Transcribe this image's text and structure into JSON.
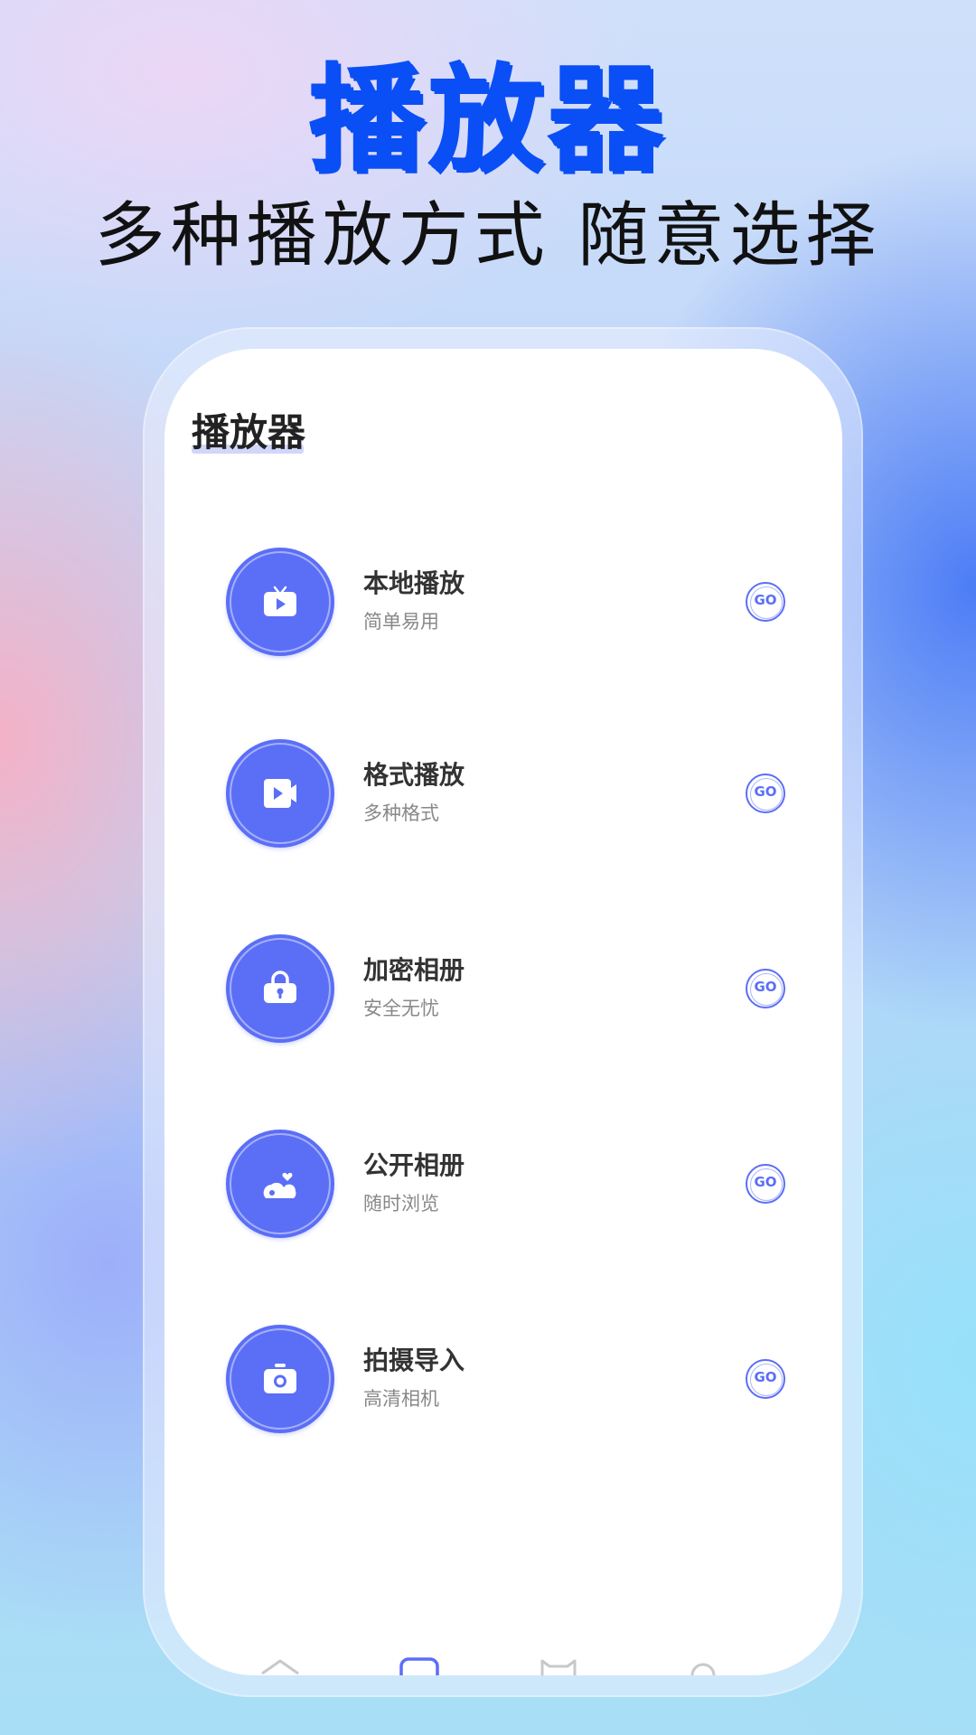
{
  "hero": {
    "title": "播放器",
    "subtitle": "多种播放方式 随意选择"
  },
  "screen": {
    "title": "播放器"
  },
  "colors": {
    "accent": "#5b6ef6",
    "hero_title": "#0a4ef5"
  },
  "menu": [
    {
      "title": "本地播放",
      "subtitle": "简单易用",
      "icon": "tv-play-icon",
      "go": "GO"
    },
    {
      "title": "格式播放",
      "subtitle": "多种格式",
      "icon": "video-camera-icon",
      "go": "GO"
    },
    {
      "title": "加密相册",
      "subtitle": "安全无忧",
      "icon": "lock-bag-icon",
      "go": "GO"
    },
    {
      "title": "公开相册",
      "subtitle": "随时浏览",
      "icon": "heart-cloud-icon",
      "go": "GO"
    },
    {
      "title": "拍摄导入",
      "subtitle": "高清相机",
      "icon": "camera-icon",
      "go": "GO"
    }
  ],
  "tabs": [
    {
      "icon": "home-icon"
    },
    {
      "icon": "player-icon"
    },
    {
      "icon": "cat-icon"
    },
    {
      "icon": "profile-icon"
    }
  ]
}
